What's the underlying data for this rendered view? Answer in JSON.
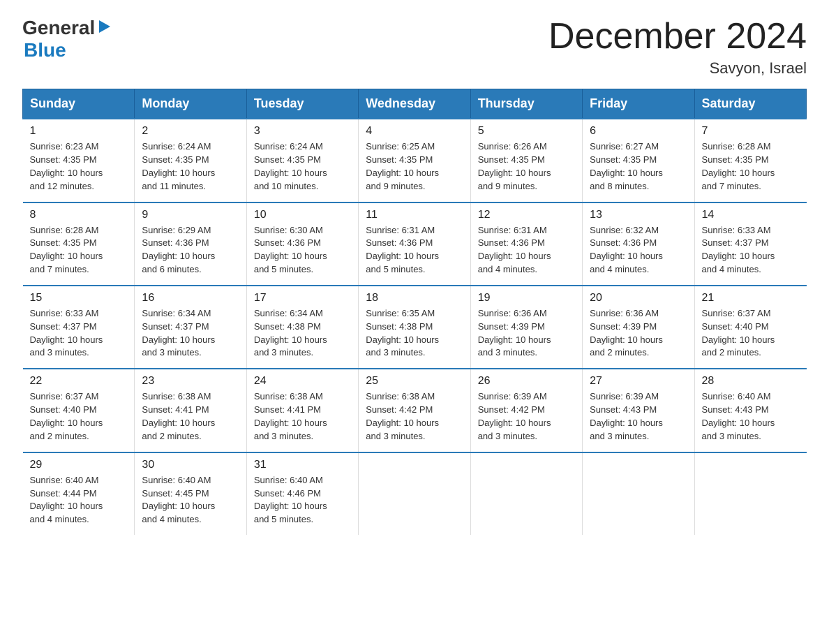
{
  "header": {
    "logo_general": "General",
    "logo_arrow": "▶",
    "logo_blue": "Blue",
    "title": "December 2024",
    "subtitle": "Savyon, Israel"
  },
  "days_of_week": [
    "Sunday",
    "Monday",
    "Tuesday",
    "Wednesday",
    "Thursday",
    "Friday",
    "Saturday"
  ],
  "weeks": [
    [
      {
        "day": "1",
        "sunrise": "6:23 AM",
        "sunset": "4:35 PM",
        "daylight": "10 hours and 12 minutes."
      },
      {
        "day": "2",
        "sunrise": "6:24 AM",
        "sunset": "4:35 PM",
        "daylight": "10 hours and 11 minutes."
      },
      {
        "day": "3",
        "sunrise": "6:24 AM",
        "sunset": "4:35 PM",
        "daylight": "10 hours and 10 minutes."
      },
      {
        "day": "4",
        "sunrise": "6:25 AM",
        "sunset": "4:35 PM",
        "daylight": "10 hours and 9 minutes."
      },
      {
        "day": "5",
        "sunrise": "6:26 AM",
        "sunset": "4:35 PM",
        "daylight": "10 hours and 9 minutes."
      },
      {
        "day": "6",
        "sunrise": "6:27 AM",
        "sunset": "4:35 PM",
        "daylight": "10 hours and 8 minutes."
      },
      {
        "day": "7",
        "sunrise": "6:28 AM",
        "sunset": "4:35 PM",
        "daylight": "10 hours and 7 minutes."
      }
    ],
    [
      {
        "day": "8",
        "sunrise": "6:28 AM",
        "sunset": "4:35 PM",
        "daylight": "10 hours and 7 minutes."
      },
      {
        "day": "9",
        "sunrise": "6:29 AM",
        "sunset": "4:36 PM",
        "daylight": "10 hours and 6 minutes."
      },
      {
        "day": "10",
        "sunrise": "6:30 AM",
        "sunset": "4:36 PM",
        "daylight": "10 hours and 5 minutes."
      },
      {
        "day": "11",
        "sunrise": "6:31 AM",
        "sunset": "4:36 PM",
        "daylight": "10 hours and 5 minutes."
      },
      {
        "day": "12",
        "sunrise": "6:31 AM",
        "sunset": "4:36 PM",
        "daylight": "10 hours and 4 minutes."
      },
      {
        "day": "13",
        "sunrise": "6:32 AM",
        "sunset": "4:36 PM",
        "daylight": "10 hours and 4 minutes."
      },
      {
        "day": "14",
        "sunrise": "6:33 AM",
        "sunset": "4:37 PM",
        "daylight": "10 hours and 4 minutes."
      }
    ],
    [
      {
        "day": "15",
        "sunrise": "6:33 AM",
        "sunset": "4:37 PM",
        "daylight": "10 hours and 3 minutes."
      },
      {
        "day": "16",
        "sunrise": "6:34 AM",
        "sunset": "4:37 PM",
        "daylight": "10 hours and 3 minutes."
      },
      {
        "day": "17",
        "sunrise": "6:34 AM",
        "sunset": "4:38 PM",
        "daylight": "10 hours and 3 minutes."
      },
      {
        "day": "18",
        "sunrise": "6:35 AM",
        "sunset": "4:38 PM",
        "daylight": "10 hours and 3 minutes."
      },
      {
        "day": "19",
        "sunrise": "6:36 AM",
        "sunset": "4:39 PM",
        "daylight": "10 hours and 3 minutes."
      },
      {
        "day": "20",
        "sunrise": "6:36 AM",
        "sunset": "4:39 PM",
        "daylight": "10 hours and 2 minutes."
      },
      {
        "day": "21",
        "sunrise": "6:37 AM",
        "sunset": "4:40 PM",
        "daylight": "10 hours and 2 minutes."
      }
    ],
    [
      {
        "day": "22",
        "sunrise": "6:37 AM",
        "sunset": "4:40 PM",
        "daylight": "10 hours and 2 minutes."
      },
      {
        "day": "23",
        "sunrise": "6:38 AM",
        "sunset": "4:41 PM",
        "daylight": "10 hours and 2 minutes."
      },
      {
        "day": "24",
        "sunrise": "6:38 AM",
        "sunset": "4:41 PM",
        "daylight": "10 hours and 3 minutes."
      },
      {
        "day": "25",
        "sunrise": "6:38 AM",
        "sunset": "4:42 PM",
        "daylight": "10 hours and 3 minutes."
      },
      {
        "day": "26",
        "sunrise": "6:39 AM",
        "sunset": "4:42 PM",
        "daylight": "10 hours and 3 minutes."
      },
      {
        "day": "27",
        "sunrise": "6:39 AM",
        "sunset": "4:43 PM",
        "daylight": "10 hours and 3 minutes."
      },
      {
        "day": "28",
        "sunrise": "6:40 AM",
        "sunset": "4:43 PM",
        "daylight": "10 hours and 3 minutes."
      }
    ],
    [
      {
        "day": "29",
        "sunrise": "6:40 AM",
        "sunset": "4:44 PM",
        "daylight": "10 hours and 4 minutes."
      },
      {
        "day": "30",
        "sunrise": "6:40 AM",
        "sunset": "4:45 PM",
        "daylight": "10 hours and 4 minutes."
      },
      {
        "day": "31",
        "sunrise": "6:40 AM",
        "sunset": "4:46 PM",
        "daylight": "10 hours and 5 minutes."
      },
      null,
      null,
      null,
      null
    ]
  ],
  "labels": {
    "sunrise": "Sunrise:",
    "sunset": "Sunset:",
    "daylight": "Daylight:"
  }
}
